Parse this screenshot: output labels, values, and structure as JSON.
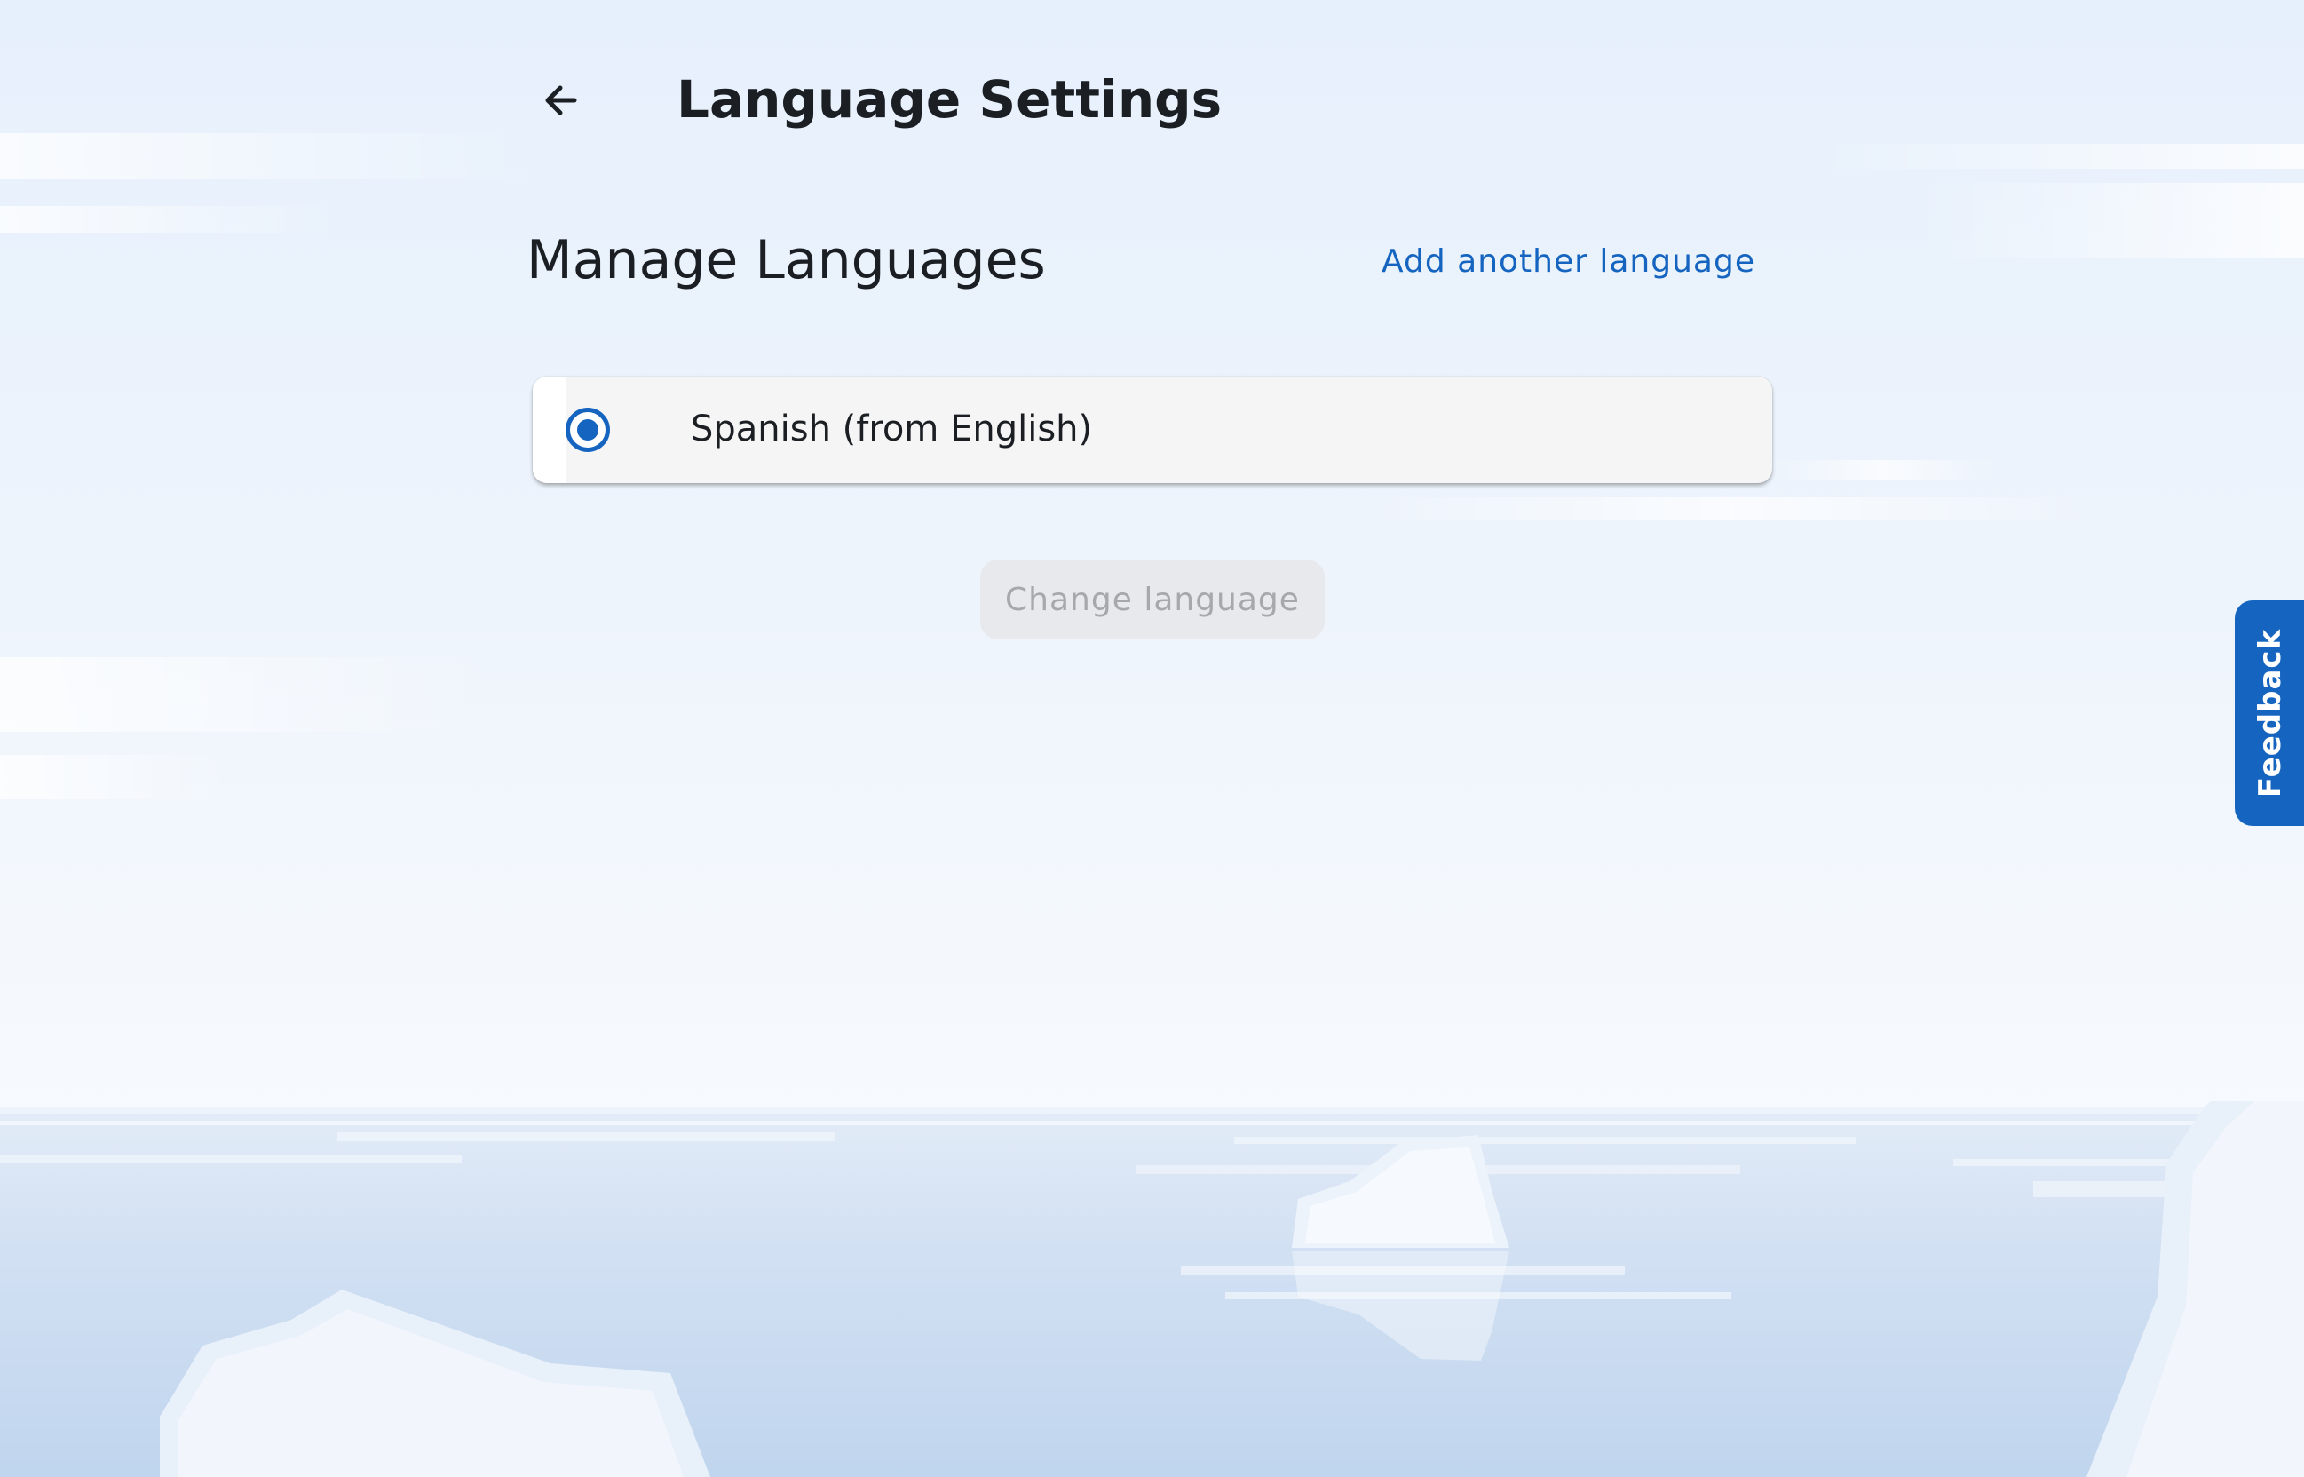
{
  "header": {
    "title": "Language Settings",
    "back_icon": "arrow-left-icon"
  },
  "manage": {
    "title": "Manage Languages",
    "add_link": "Add another language"
  },
  "languages": [
    {
      "label": "Spanish (from English)",
      "selected": true
    }
  ],
  "actions": {
    "change_language": "Change language",
    "change_language_enabled": false
  },
  "feedback": {
    "label": "Feedback"
  },
  "colors": {
    "accent": "#1565c0",
    "text": "#1b1f24",
    "disabled_bg": "#e8e9ec",
    "disabled_text": "#a6a8ad"
  }
}
